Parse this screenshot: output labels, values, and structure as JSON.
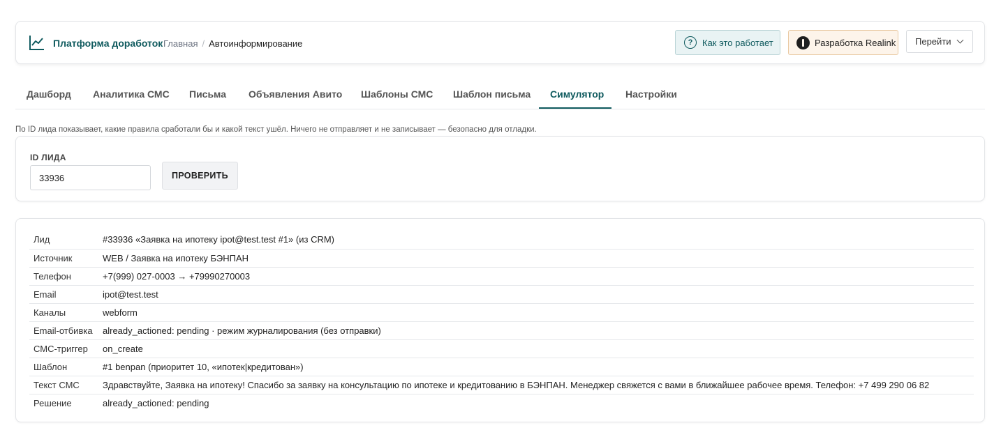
{
  "header": {
    "brand": "Платформа доработок",
    "breadcrumbs": {
      "home": "Главная",
      "separator": "/",
      "current": "Автоинформирование"
    },
    "how_it_works": "Как это работает",
    "realink": "Разработка Realink",
    "goto": "Перейти"
  },
  "tabs": [
    {
      "label": "Дашборд",
      "active": false
    },
    {
      "label": "Аналитика СМС",
      "active": false
    },
    {
      "label": "Письма",
      "active": false
    },
    {
      "label": "Объявления Авито",
      "active": false
    },
    {
      "label": "Шаблоны СМС",
      "active": false
    },
    {
      "label": "Шаблон письма",
      "active": false
    },
    {
      "label": "Симулятор",
      "active": true
    },
    {
      "label": "Настройки",
      "active": false
    }
  ],
  "hint": "По ID лида показывает, какие правила сработали бы и какой текст ушёл. Ничего не отправляет и не записывает — безопасно для отладки.",
  "form": {
    "label": "ID ЛИДА",
    "value": "33936",
    "button": "ПРОВЕРИТЬ"
  },
  "result": [
    {
      "key": "Лид",
      "value": "#33936 «Заявка на ипотеку ipot@test.test #1» (из CRM)"
    },
    {
      "key": "Источник",
      "value": "WEB / Заявка на ипотеку БЭНПАН"
    },
    {
      "key": "Телефон",
      "value": "+7(999) 027-0003 → +79990270003"
    },
    {
      "key": "Email",
      "value": "ipot@test.test"
    },
    {
      "key": "Каналы",
      "value": "webform"
    },
    {
      "key": "Email-отбивка",
      "value": "already_actioned: pending · режим журналирования (без отправки)"
    },
    {
      "key": "СМС-триггер",
      "value": "on_create"
    },
    {
      "key": "Шаблон",
      "value": "#1 benpan (приоритет 10, «ипотек|кредитован»)"
    },
    {
      "key": "Текст СМС",
      "value": "Здравствуйте, Заявка на ипотеку! Спасибо за заявку на консультацию по ипотеке и кредитованию в БЭНПАН. Менеджер свяжется с вами в ближайшее рабочее время. Телефон: +7 499 290 06 82"
    },
    {
      "key": "Решение",
      "value": "already_actioned: pending"
    }
  ],
  "colors": {
    "accent": "#0f5a5e",
    "how_bg": "#e9f3f4",
    "realink_bg": "#fdf4ea"
  }
}
